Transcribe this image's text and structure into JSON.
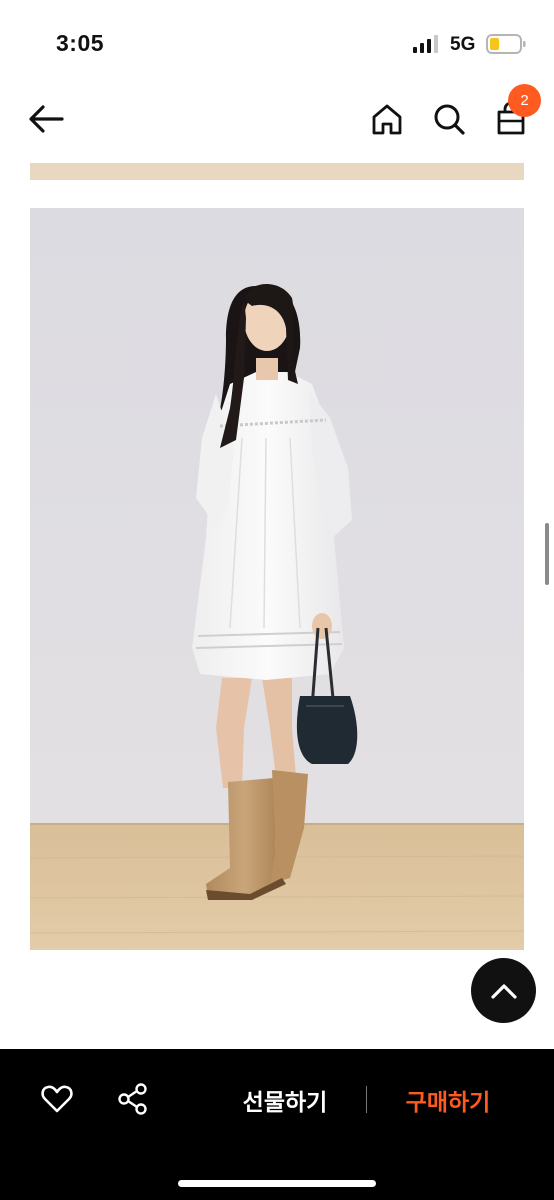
{
  "status_bar": {
    "time": "3:05",
    "network": "5G",
    "signal_icon": "cellular-signal-icon",
    "battery_icon": "battery-low-icon",
    "battery_color": "#f5c518"
  },
  "nav": {
    "back_icon": "arrow-left-icon",
    "home_icon": "home-icon",
    "search_icon": "search-icon",
    "cart_icon": "shopping-bag-icon",
    "cart_count": "2",
    "badge_color": "#ff5a1f"
  },
  "content": {
    "photo_alt": "product-model-photo"
  },
  "scroll_top": {
    "icon": "chevron-up-icon"
  },
  "bottom_bar": {
    "like_icon": "heart-icon",
    "share_icon": "share-icon",
    "gift_label": "선물하기",
    "buy_label": "구매하기",
    "accent_color": "#ff5a1f"
  }
}
